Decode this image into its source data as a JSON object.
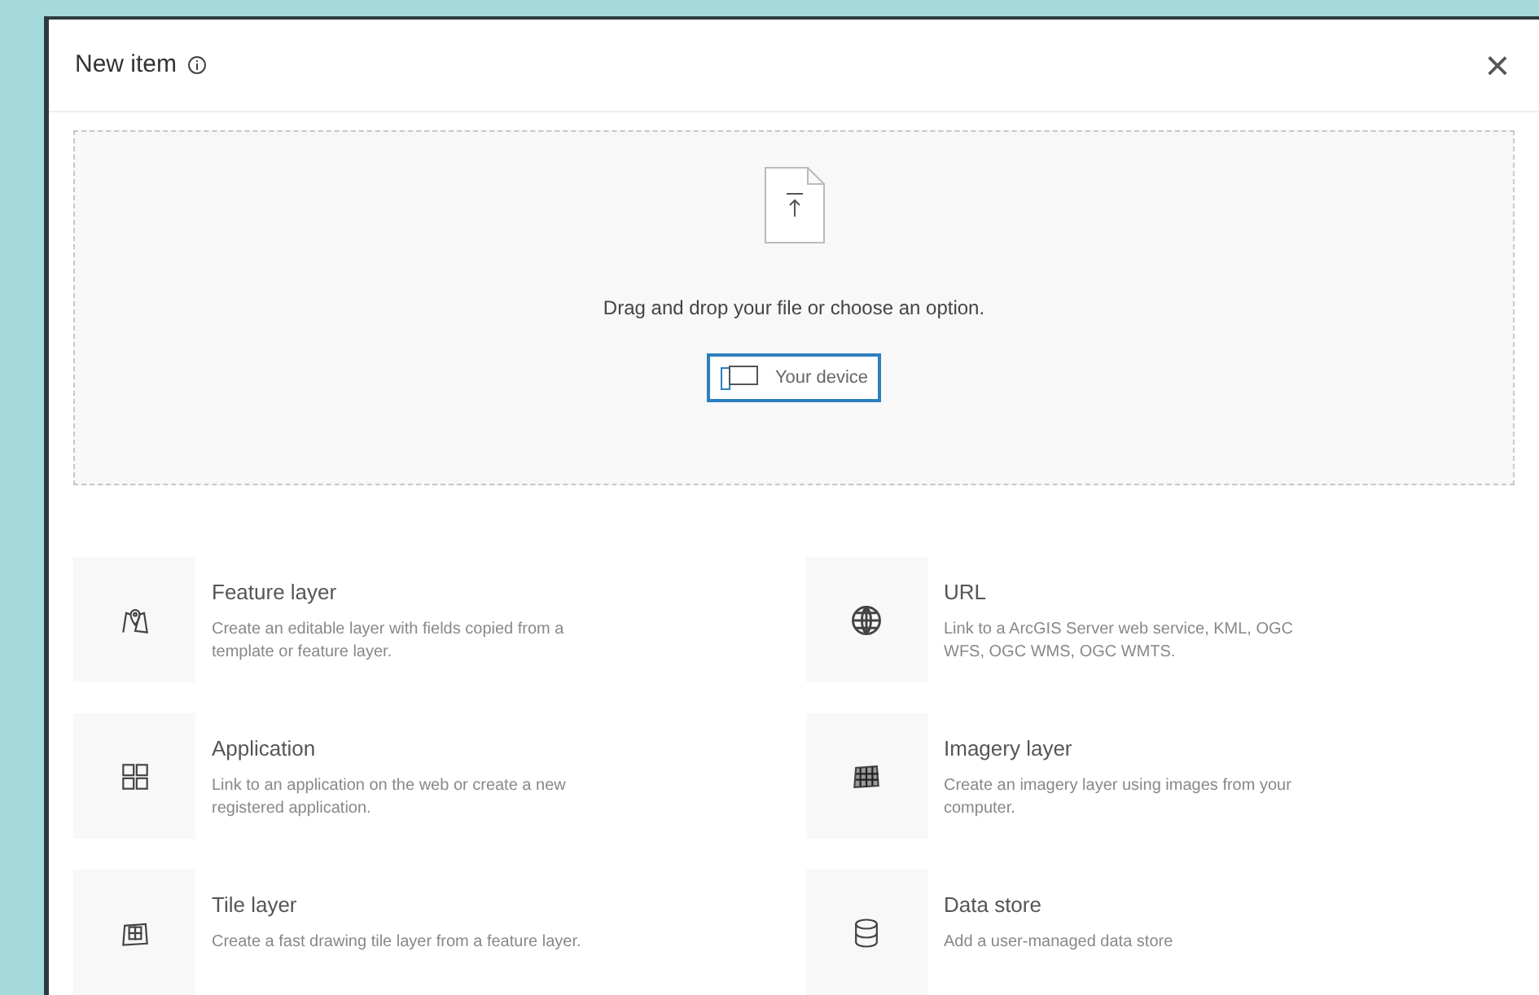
{
  "dialog": {
    "title": "New item",
    "close": "×"
  },
  "dropzone": {
    "message": "Drag and drop your file or choose an option.",
    "button": "Your device"
  },
  "options": [
    {
      "kind": "feature",
      "title": "Feature layer",
      "description": "Create an editable layer with fields copied from a template or feature layer."
    },
    {
      "kind": "url",
      "title": "URL",
      "description": "Link to a ArcGIS Server web service, KML, OGC WFS, OGC WMS, OGC WMTS."
    },
    {
      "kind": "application",
      "title": "Application",
      "description": "Link to an application on the web or create a new registered application."
    },
    {
      "kind": "imagery",
      "title": "Imagery layer",
      "description": "Create an imagery layer using images from your computer."
    },
    {
      "kind": "tile",
      "title": "Tile layer",
      "description": "Create a fast drawing tile layer from a feature layer."
    },
    {
      "kind": "datastore",
      "title": "Data store",
      "description": "Add a user-managed data store"
    }
  ]
}
